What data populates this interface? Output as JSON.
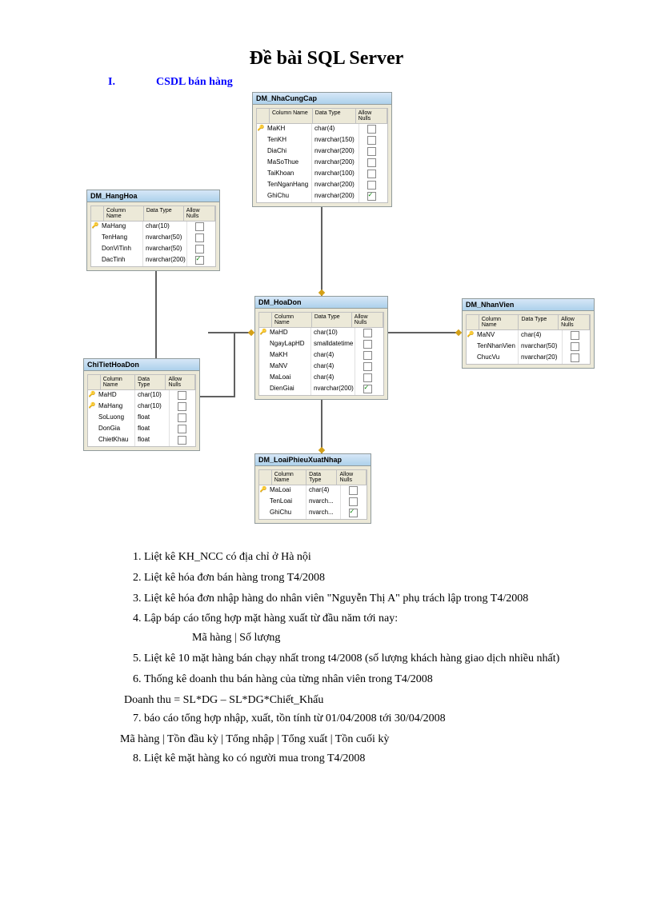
{
  "title": "Đề bài SQL Server",
  "section": {
    "num": "I.",
    "label": "CSDL bán hàng"
  },
  "tables": {
    "nhacungcap": {
      "title": "DM_NhaCungCap",
      "headers": [
        "Column Name",
        "Data Type",
        "Allow Nulls"
      ],
      "rows": [
        {
          "key": true,
          "name": "MaKH",
          "type": "char(4)",
          "null": false
        },
        {
          "key": false,
          "name": "TenKH",
          "type": "nvarchar(150)",
          "null": false
        },
        {
          "key": false,
          "name": "DiaChi",
          "type": "nvarchar(200)",
          "null": false
        },
        {
          "key": false,
          "name": "MaSoThue",
          "type": "nvarchar(200)",
          "null": false
        },
        {
          "key": false,
          "name": "TaiKhoan",
          "type": "nvarchar(100)",
          "null": false
        },
        {
          "key": false,
          "name": "TenNganHang",
          "type": "nvarchar(200)",
          "null": false
        },
        {
          "key": false,
          "name": "GhiChu",
          "type": "nvarchar(200)",
          "null": true
        }
      ]
    },
    "hanghoa": {
      "title": "DM_HangHoa",
      "headers": [
        "Column Name",
        "Data Type",
        "Allow Nulls"
      ],
      "rows": [
        {
          "key": true,
          "name": "MaHang",
          "type": "char(10)",
          "null": false
        },
        {
          "key": false,
          "name": "TenHang",
          "type": "nvarchar(50)",
          "null": false
        },
        {
          "key": false,
          "name": "DonViTinh",
          "type": "nvarchar(50)",
          "null": false
        },
        {
          "key": false,
          "name": "DacTinh",
          "type": "nvarchar(200)",
          "null": true
        }
      ]
    },
    "hoadon": {
      "title": "DM_HoaDon",
      "headers": [
        "Column Name",
        "Data Type",
        "Allow Nulls"
      ],
      "rows": [
        {
          "key": true,
          "name": "MaHD",
          "type": "char(10)",
          "null": false
        },
        {
          "key": false,
          "name": "NgayLapHD",
          "type": "smalldatetime",
          "null": false
        },
        {
          "key": false,
          "name": "MaKH",
          "type": "char(4)",
          "null": false
        },
        {
          "key": false,
          "name": "MaNV",
          "type": "char(4)",
          "null": false
        },
        {
          "key": false,
          "name": "MaLoai",
          "type": "char(4)",
          "null": false
        },
        {
          "key": false,
          "name": "DienGiai",
          "type": "nvarchar(200)",
          "null": true
        }
      ]
    },
    "nhanvien": {
      "title": "DM_NhanVien",
      "headers": [
        "Column Name",
        "Data Type",
        "Allow Nulls"
      ],
      "rows": [
        {
          "key": true,
          "name": "MaNV",
          "type": "char(4)",
          "null": false
        },
        {
          "key": false,
          "name": "TenNhanVien",
          "type": "nvarchar(50)",
          "null": false
        },
        {
          "key": false,
          "name": "ChucVu",
          "type": "nvarchar(20)",
          "null": false
        }
      ]
    },
    "chitiethoadon": {
      "title": "ChiTietHoaDon",
      "headers": [
        "Column Name",
        "Data Type",
        "Allow Nulls"
      ],
      "rows": [
        {
          "key": true,
          "name": "MaHD",
          "type": "char(10)",
          "null": false
        },
        {
          "key": true,
          "name": "MaHang",
          "type": "char(10)",
          "null": false
        },
        {
          "key": false,
          "name": "SoLuong",
          "type": "float",
          "null": false
        },
        {
          "key": false,
          "name": "DonGia",
          "type": "float",
          "null": false
        },
        {
          "key": false,
          "name": "ChietKhau",
          "type": "float",
          "null": false
        }
      ]
    },
    "loaiphieu": {
      "title": "DM_LoaiPhieuXuatNhap",
      "headers": [
        "Column Name",
        "Data Type",
        "Allow Nulls"
      ],
      "rows": [
        {
          "key": true,
          "name": "MaLoai",
          "type": "char(4)",
          "null": false
        },
        {
          "key": false,
          "name": "TenLoai",
          "type": "nvarch...",
          "null": false
        },
        {
          "key": false,
          "name": "GhiChu",
          "type": "nvarch...",
          "null": true
        }
      ]
    }
  },
  "questions": {
    "q1": "Liệt kê KH_NCC có địa chỉ ở Hà nội",
    "q2": "Liệt kê hóa đơn bán hàng trong T4/2008",
    "q3": "Liệt kê hóa đơn nhập hàng do nhân viên \"Nguyễn Thị A\" phụ trách lập trong T4/2008",
    "q4": "Lập báp cáo tổng hợp mặt hàng xuất từ đầu năm tới nay:",
    "q4_sub": "Mã hàng |   Số lượng",
    "q5": "Liệt kê 10 mặt hàng bán chạy nhất trong t4/2008 (số lượng khách hàng giao dịch nhiều nhất)",
    "q6": "Thống kê doanh thu bán hàng của từng nhân viên trong T4/2008",
    "q6_formula": "Doanh thu = SL*DG – SL*DG*Chiết_Khấu",
    "q7": "báo cáo tổng hợp nhập, xuất, tồn tính từ 01/04/2008 tới 30/04/2008",
    "q7_sub": "Mã hàng | Tồn đầu kỳ | Tổng nhập | Tổng xuất | Tồn cuối kỳ",
    "q8": "Liệt kê mặt hàng ko có người mua trong T4/2008"
  }
}
